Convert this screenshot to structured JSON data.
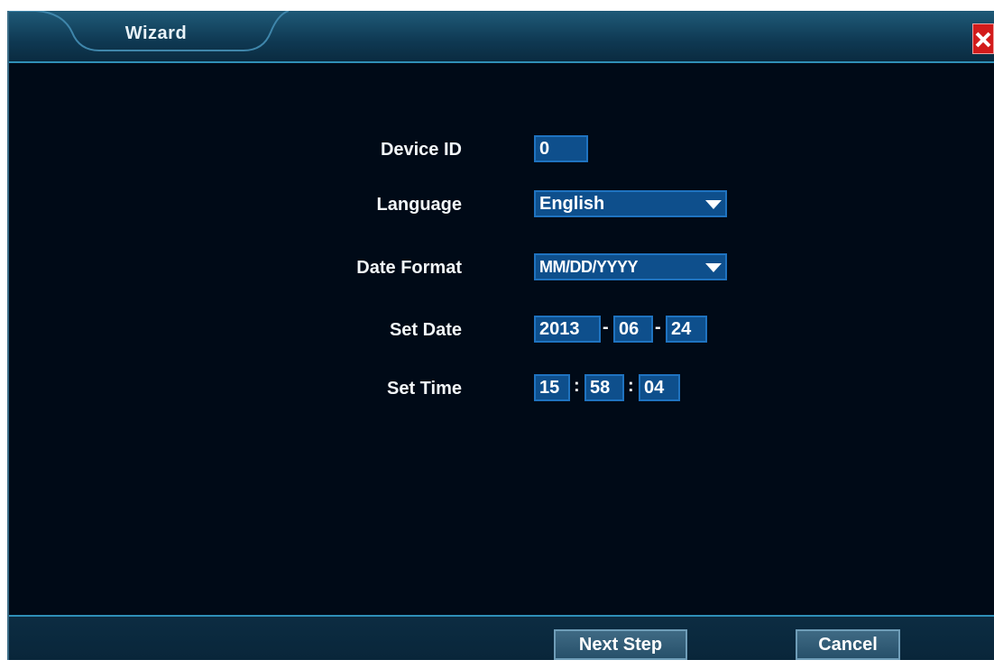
{
  "window": {
    "title": "Wizard",
    "close_icon": "close-icon",
    "close_color": "#d21b1b"
  },
  "form": {
    "device_id": {
      "label": "Device ID",
      "value": "0"
    },
    "language": {
      "label": "Language",
      "value": "English"
    },
    "date_format": {
      "label": "Date Format",
      "value": "MM/DD/YYYY"
    },
    "set_date": {
      "label": "Set Date",
      "year": "2013",
      "month": "06",
      "day": "24",
      "separator": "-"
    },
    "set_time": {
      "label": "Set Time",
      "hour": "15",
      "minute": "58",
      "second": "04",
      "separator": ":"
    }
  },
  "footer": {
    "next_label": "Next Step",
    "cancel_label": "Cancel"
  },
  "colors": {
    "background": "#000a17",
    "field": "#0e4f8c",
    "accent": "#2f8fb7"
  }
}
